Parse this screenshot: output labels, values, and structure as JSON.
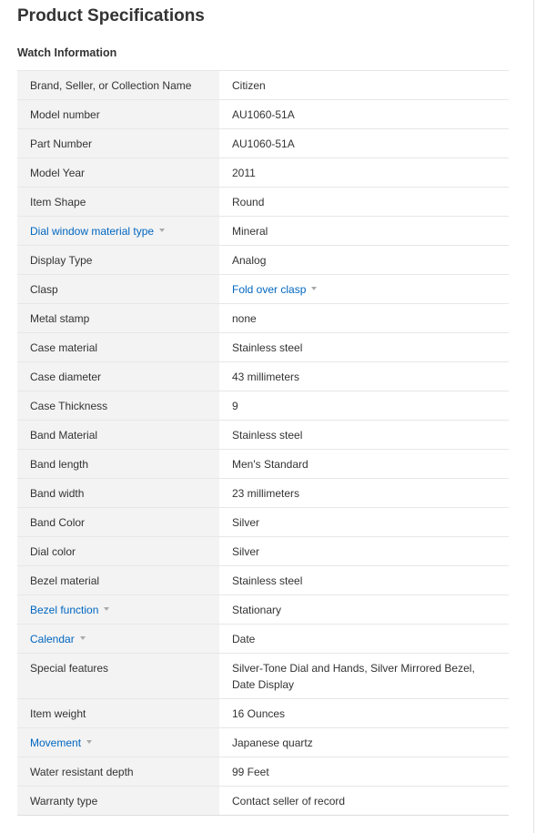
{
  "page_title": "Product Specifications",
  "section_title": "Watch Information",
  "specs": [
    {
      "label": "Brand, Seller, or Collection Name",
      "value": "Citizen"
    },
    {
      "label": "Model number",
      "value": "AU1060-51A"
    },
    {
      "label": "Part Number",
      "value": "AU1060-51A"
    },
    {
      "label": "Model Year",
      "value": "2011"
    },
    {
      "label": "Item Shape",
      "value": "Round"
    },
    {
      "label": "Dial window material type",
      "value": "Mineral"
    },
    {
      "label": "Display Type",
      "value": "Analog"
    },
    {
      "label": "Clasp",
      "value": "Fold over clasp"
    },
    {
      "label": "Metal stamp",
      "value": "none"
    },
    {
      "label": "Case material",
      "value": "Stainless steel"
    },
    {
      "label": "Case diameter",
      "value": "43 millimeters"
    },
    {
      "label": "Case Thickness",
      "value": "9"
    },
    {
      "label": "Band Material",
      "value": "Stainless steel"
    },
    {
      "label": "Band length",
      "value": "Men's Standard"
    },
    {
      "label": "Band width",
      "value": "23 millimeters"
    },
    {
      "label": "Band Color",
      "value": "Silver"
    },
    {
      "label": "Dial color",
      "value": "Silver"
    },
    {
      "label": "Bezel material",
      "value": "Stainless steel"
    },
    {
      "label": "Bezel function",
      "value": "Stationary"
    },
    {
      "label": "Calendar",
      "value": "Date"
    },
    {
      "label": "Special features",
      "value": "Silver-Tone Dial and Hands, Silver Mirrored Bezel, Date Display"
    },
    {
      "label": "Item weight",
      "value": "16 Ounces"
    },
    {
      "label": "Movement",
      "value": "Japanese quartz"
    },
    {
      "label": "Water resistant depth",
      "value": "99 Feet"
    },
    {
      "label": "Warranty type",
      "value": "Contact seller of record"
    }
  ],
  "icons": {
    "dropdown": "caret-down-icon"
  },
  "colors": {
    "link": "#0066c0",
    "label_bg": "#f3f3f3",
    "border": "#e7e7e7",
    "text": "#333333"
  }
}
